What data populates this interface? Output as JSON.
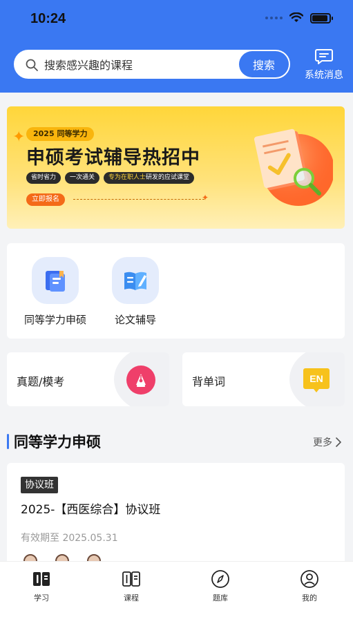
{
  "status_bar": {
    "time": "10:24"
  },
  "header": {
    "search": {
      "placeholder": "搜索感兴趣的课程",
      "button_label": "搜索"
    },
    "messages_label": "系统消息"
  },
  "banner": {
    "tag": "2025 同等学力",
    "title": "申硕考试辅导热招中",
    "pills": [
      "省时省力",
      "一次通关"
    ],
    "pill_highlight": "专为在职人士",
    "pill_rest": "研发的应试课堂",
    "cta": "立即报名"
  },
  "categories": [
    {
      "label": "同等学力申硕",
      "icon": "folder-book-icon"
    },
    {
      "label": "论文辅导",
      "icon": "open-book-pen-icon"
    }
  ],
  "tools": [
    {
      "label": "真题/模考",
      "icon": "pen-nib-icon",
      "color": "#ef3f6a"
    },
    {
      "label": "背单词",
      "icon": "en-badge-icon",
      "icon_text": "EN",
      "color": "#f7c21c"
    }
  ],
  "section": {
    "title": "同等学力申硕",
    "more": "更多"
  },
  "course": {
    "badge": "协议班",
    "title": "2025-【西医综合】协议班",
    "expiry": "有效期至 2025.05.31"
  },
  "tabbar": [
    {
      "label": "学习",
      "icon": "study-book-icon",
      "active": true
    },
    {
      "label": "课程",
      "icon": "course-book-icon",
      "active": false
    },
    {
      "label": "题库",
      "icon": "compass-icon",
      "active": false
    },
    {
      "label": "我的",
      "icon": "user-icon",
      "active": false
    }
  ],
  "colors": {
    "primary": "#3a78f2",
    "accent_orange": "#f46a18",
    "banner_yellow": "#ffd63a"
  }
}
